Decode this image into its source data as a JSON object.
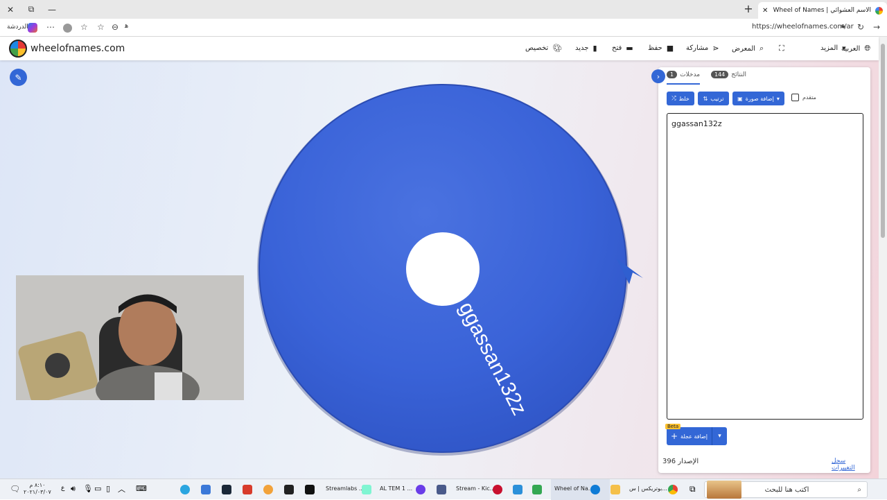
{
  "browser": {
    "tab_title": "الاسم العشوائي | Wheel of Names",
    "tab_close": "✕",
    "new_tab": "+",
    "url": "https://wheelofnames.com/ar",
    "profile_label": "الدردشة",
    "window_controls": [
      "✕",
      "⧉",
      "—"
    ]
  },
  "header": {
    "site_name": "wheelofnames.com",
    "nav": {
      "customize": "تخصيص",
      "new": "جديد",
      "open": "فتح",
      "save": "حفظ",
      "share": "مشاركة",
      "gallery": "المعرض",
      "more": "المزيد",
      "language": "العربية"
    }
  },
  "wheel": {
    "entry_label": "ggassan132z",
    "color": "#3a63d8"
  },
  "panel": {
    "tabs": {
      "entries_label": "مدخلات",
      "entries_count": "1",
      "results_label": "النتائج",
      "results_count": "144"
    },
    "buttons": {
      "shuffle": "خلط",
      "sort": "ترتيب",
      "add_image": "إضافة صورة",
      "advanced": "متقدم"
    },
    "entries_text": "ggassan132z",
    "add_wheel_button": "إضافة عجلة",
    "beta_badge": "Beta",
    "version_label": "الإصدار",
    "version_number": "396",
    "changelog_link": "سجل التغييرات"
  },
  "taskbar": {
    "search_placeholder": "اكتب هنا للبحث",
    "clock_time": "٨:١٠ م",
    "clock_date": "٢٠٢١/٠٣/٠٧",
    "lang": "ع",
    "apps": [
      {
        "label": "بوتريكس | س...",
        "color": "#1a73e8"
      },
      {
        "label": "Wheel of Na...",
        "color": "#0f7bd6"
      },
      {
        "label": "Stream - Kic...",
        "color": "#c8102e"
      },
      {
        "label": "AL TEM 1 ...",
        "color": "#6a3de8"
      },
      {
        "label": "Streamlabs ...",
        "color": "#80f5d2"
      }
    ]
  }
}
